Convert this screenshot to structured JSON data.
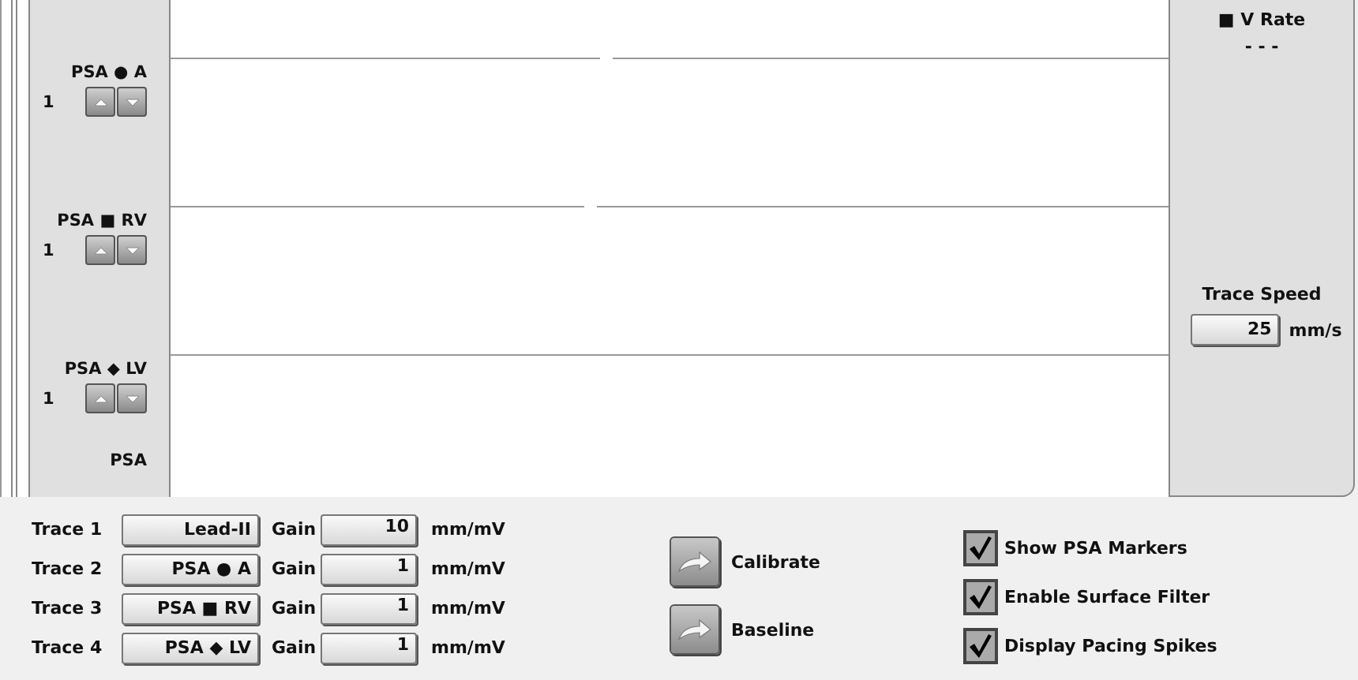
{
  "channels": [
    {
      "label": "PSA ● A",
      "scale": "1"
    },
    {
      "label": "PSA ■ RV",
      "scale": "1"
    },
    {
      "label": "PSA ◆ LV",
      "scale": "1"
    },
    {
      "label": "PSA"
    }
  ],
  "rate": {
    "label": "■ V Rate",
    "value": "- - -"
  },
  "trace_speed": {
    "label": "Trace Speed",
    "value": "25",
    "unit": "mm/s"
  },
  "traces": [
    {
      "label": "Trace 1",
      "source": "Lead-II",
      "gain_label": "Gain",
      "gain": "10",
      "unit": "mm/mV"
    },
    {
      "label": "Trace 2",
      "source": "PSA ● A",
      "gain_label": "Gain",
      "gain": "1",
      "unit": "mm/mV"
    },
    {
      "label": "Trace 3",
      "source": "PSA ■ RV",
      "gain_label": "Gain",
      "gain": "1",
      "unit": "mm/mV"
    },
    {
      "label": "Trace 4",
      "source": "PSA ◆ LV",
      "gain_label": "Gain",
      "gain": "1",
      "unit": "mm/mV"
    }
  ],
  "actions": [
    {
      "label": "Calibrate"
    },
    {
      "label": "Baseline"
    }
  ],
  "options": [
    {
      "label": "Show PSA Markers",
      "checked": true
    },
    {
      "label": "Enable Surface Filter",
      "checked": true
    },
    {
      "label": "Display Pacing Spikes",
      "checked": true
    }
  ]
}
